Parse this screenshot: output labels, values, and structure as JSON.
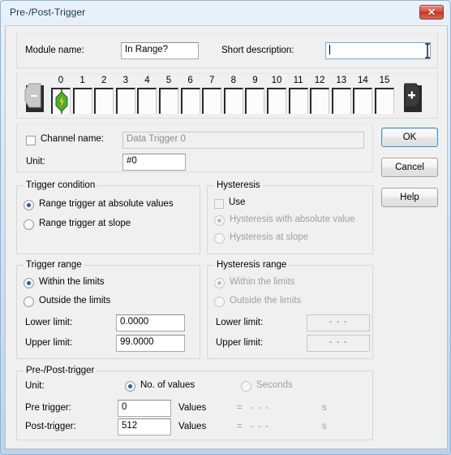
{
  "window": {
    "title": "Pre-/Post-Trigger",
    "close_icon": "close-icon",
    "close_glyph": "✕"
  },
  "top": {
    "module_name_label": "Module name:",
    "module_name_value": "In Range?",
    "short_description_label": "Short description:",
    "short_description_value": "",
    "short_description_placeholder": ""
  },
  "channels": {
    "prev_icon": "arrow-left-minus-icon",
    "next_icon": "arrow-right-plus-icon",
    "prev_glyph": "−",
    "next_glyph": "+",
    "numbers": [
      "0",
      "1",
      "2",
      "3",
      "4",
      "5",
      "6",
      "7",
      "8",
      "9",
      "10",
      "11",
      "12",
      "13",
      "14",
      "15"
    ],
    "selected_index": 0,
    "occupied_icon": "trigger-module-icon"
  },
  "identity": {
    "channel_name_label": "Channel name:",
    "channel_name_checked": false,
    "channel_name_value": "Data Trigger 0",
    "unit_label": "Unit:",
    "unit_value": "#0"
  },
  "buttons": {
    "ok": "OK",
    "cancel": "Cancel",
    "help": "Help"
  },
  "trigger_condition": {
    "legend": "Trigger condition",
    "options": [
      {
        "label": "Range trigger at absolute values",
        "selected": true
      },
      {
        "label": "Range trigger at slope",
        "selected": false
      }
    ]
  },
  "hysteresis": {
    "legend": "Hysteresis",
    "use_label": "Use",
    "use_checked": false,
    "enabled": false,
    "options": [
      {
        "label": "Hysteresis with absolute value",
        "selected": true
      },
      {
        "label": "Hysteresis  at slope",
        "selected": false
      }
    ]
  },
  "trigger_range": {
    "legend": "Trigger range",
    "options": [
      {
        "label": "Within the limits",
        "selected": true
      },
      {
        "label": "Outside the limits",
        "selected": false
      }
    ],
    "lower_label": "Lower limit:",
    "lower_value": "0.0000",
    "upper_label": "Upper limit:",
    "upper_value": "99.0000"
  },
  "hysteresis_range": {
    "legend": "Hysteresis range",
    "enabled": false,
    "options": [
      {
        "label": "Within the limits",
        "selected": true
      },
      {
        "label": "Outside the limits",
        "selected": false
      }
    ],
    "lower_label": "Lower limit:",
    "lower_value": "- - -",
    "upper_label": "Upper limit:",
    "upper_value": "- - -"
  },
  "pre_post": {
    "legend": "Pre-/Post-trigger",
    "unit_label": "Unit:",
    "unit_options": [
      {
        "label": "No. of values",
        "selected": true,
        "enabled": true
      },
      {
        "label": "Seconds",
        "selected": false,
        "enabled": false
      }
    ],
    "pre_label": "Pre trigger:",
    "pre_value": "0",
    "pre_unit": "Values",
    "pre_eq": "=",
    "pre_seconds": "- - -",
    "pre_sec_unit": "s",
    "post_label": "Post-trigger:",
    "post_value": "512",
    "post_unit": "Values",
    "post_eq": "=",
    "post_seconds": "- - -",
    "post_sec_unit": "s"
  },
  "colors": {
    "title_text": "#16374f",
    "close_red": "#d9533c",
    "radio_dot": "#1f5fa8",
    "default_button_border": "#3c8ec4",
    "module_icon_green": "#4caf2a",
    "module_icon_bolt": "#f5e02a",
    "dialog_bg": "#f0f0f0"
  }
}
